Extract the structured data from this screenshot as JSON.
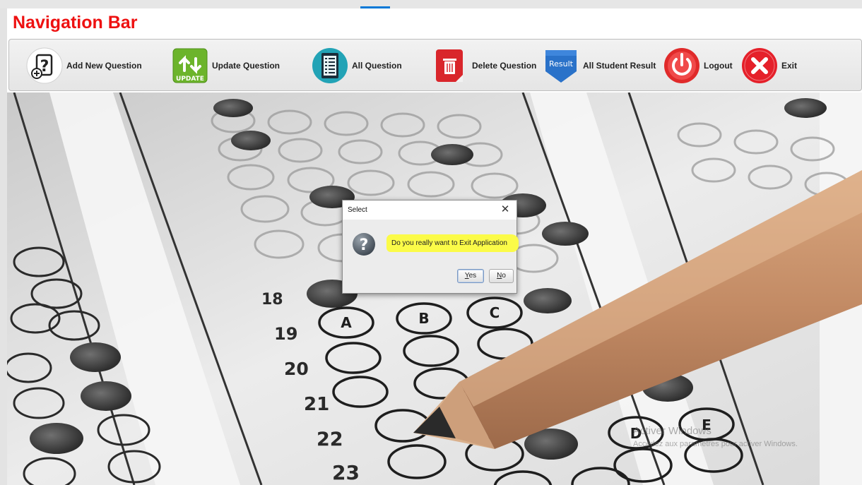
{
  "page_title": "Navigation Bar",
  "toolbar": {
    "items": [
      {
        "label": "Add New Question",
        "icon": "add-question-icon"
      },
      {
        "label": "Update Question",
        "icon": "update-icon",
        "icon_text": "UPDATE"
      },
      {
        "label": "All Question",
        "icon": "question-list-icon"
      },
      {
        "label": "Delete Question",
        "icon": "trash-icon"
      },
      {
        "label": "All Student Result",
        "icon": "result-badge-icon",
        "icon_text": "Result"
      },
      {
        "label": "Logout",
        "icon": "power-icon"
      },
      {
        "label": "Exit",
        "icon": "close-circle-icon"
      }
    ]
  },
  "background": {
    "row_numbers": [
      "18",
      "19",
      "20",
      "21",
      "22",
      "23"
    ],
    "bubble_letters": [
      "A",
      "B",
      "C",
      "D",
      "E"
    ]
  },
  "dialog": {
    "title": "Select",
    "close_glyph": "✕",
    "message": "Do you really want to Exit Application",
    "yes_mnemonic": "Y",
    "yes_rest": "es",
    "no_mnemonic": "N",
    "no_rest": "o"
  },
  "watermark": {
    "line1": "Activer Windows",
    "line2": "Accédez aux paramètres pour activer Windows."
  },
  "colors": {
    "title_red": "#ee1111",
    "highlight_yellow": "#fbfb48"
  }
}
